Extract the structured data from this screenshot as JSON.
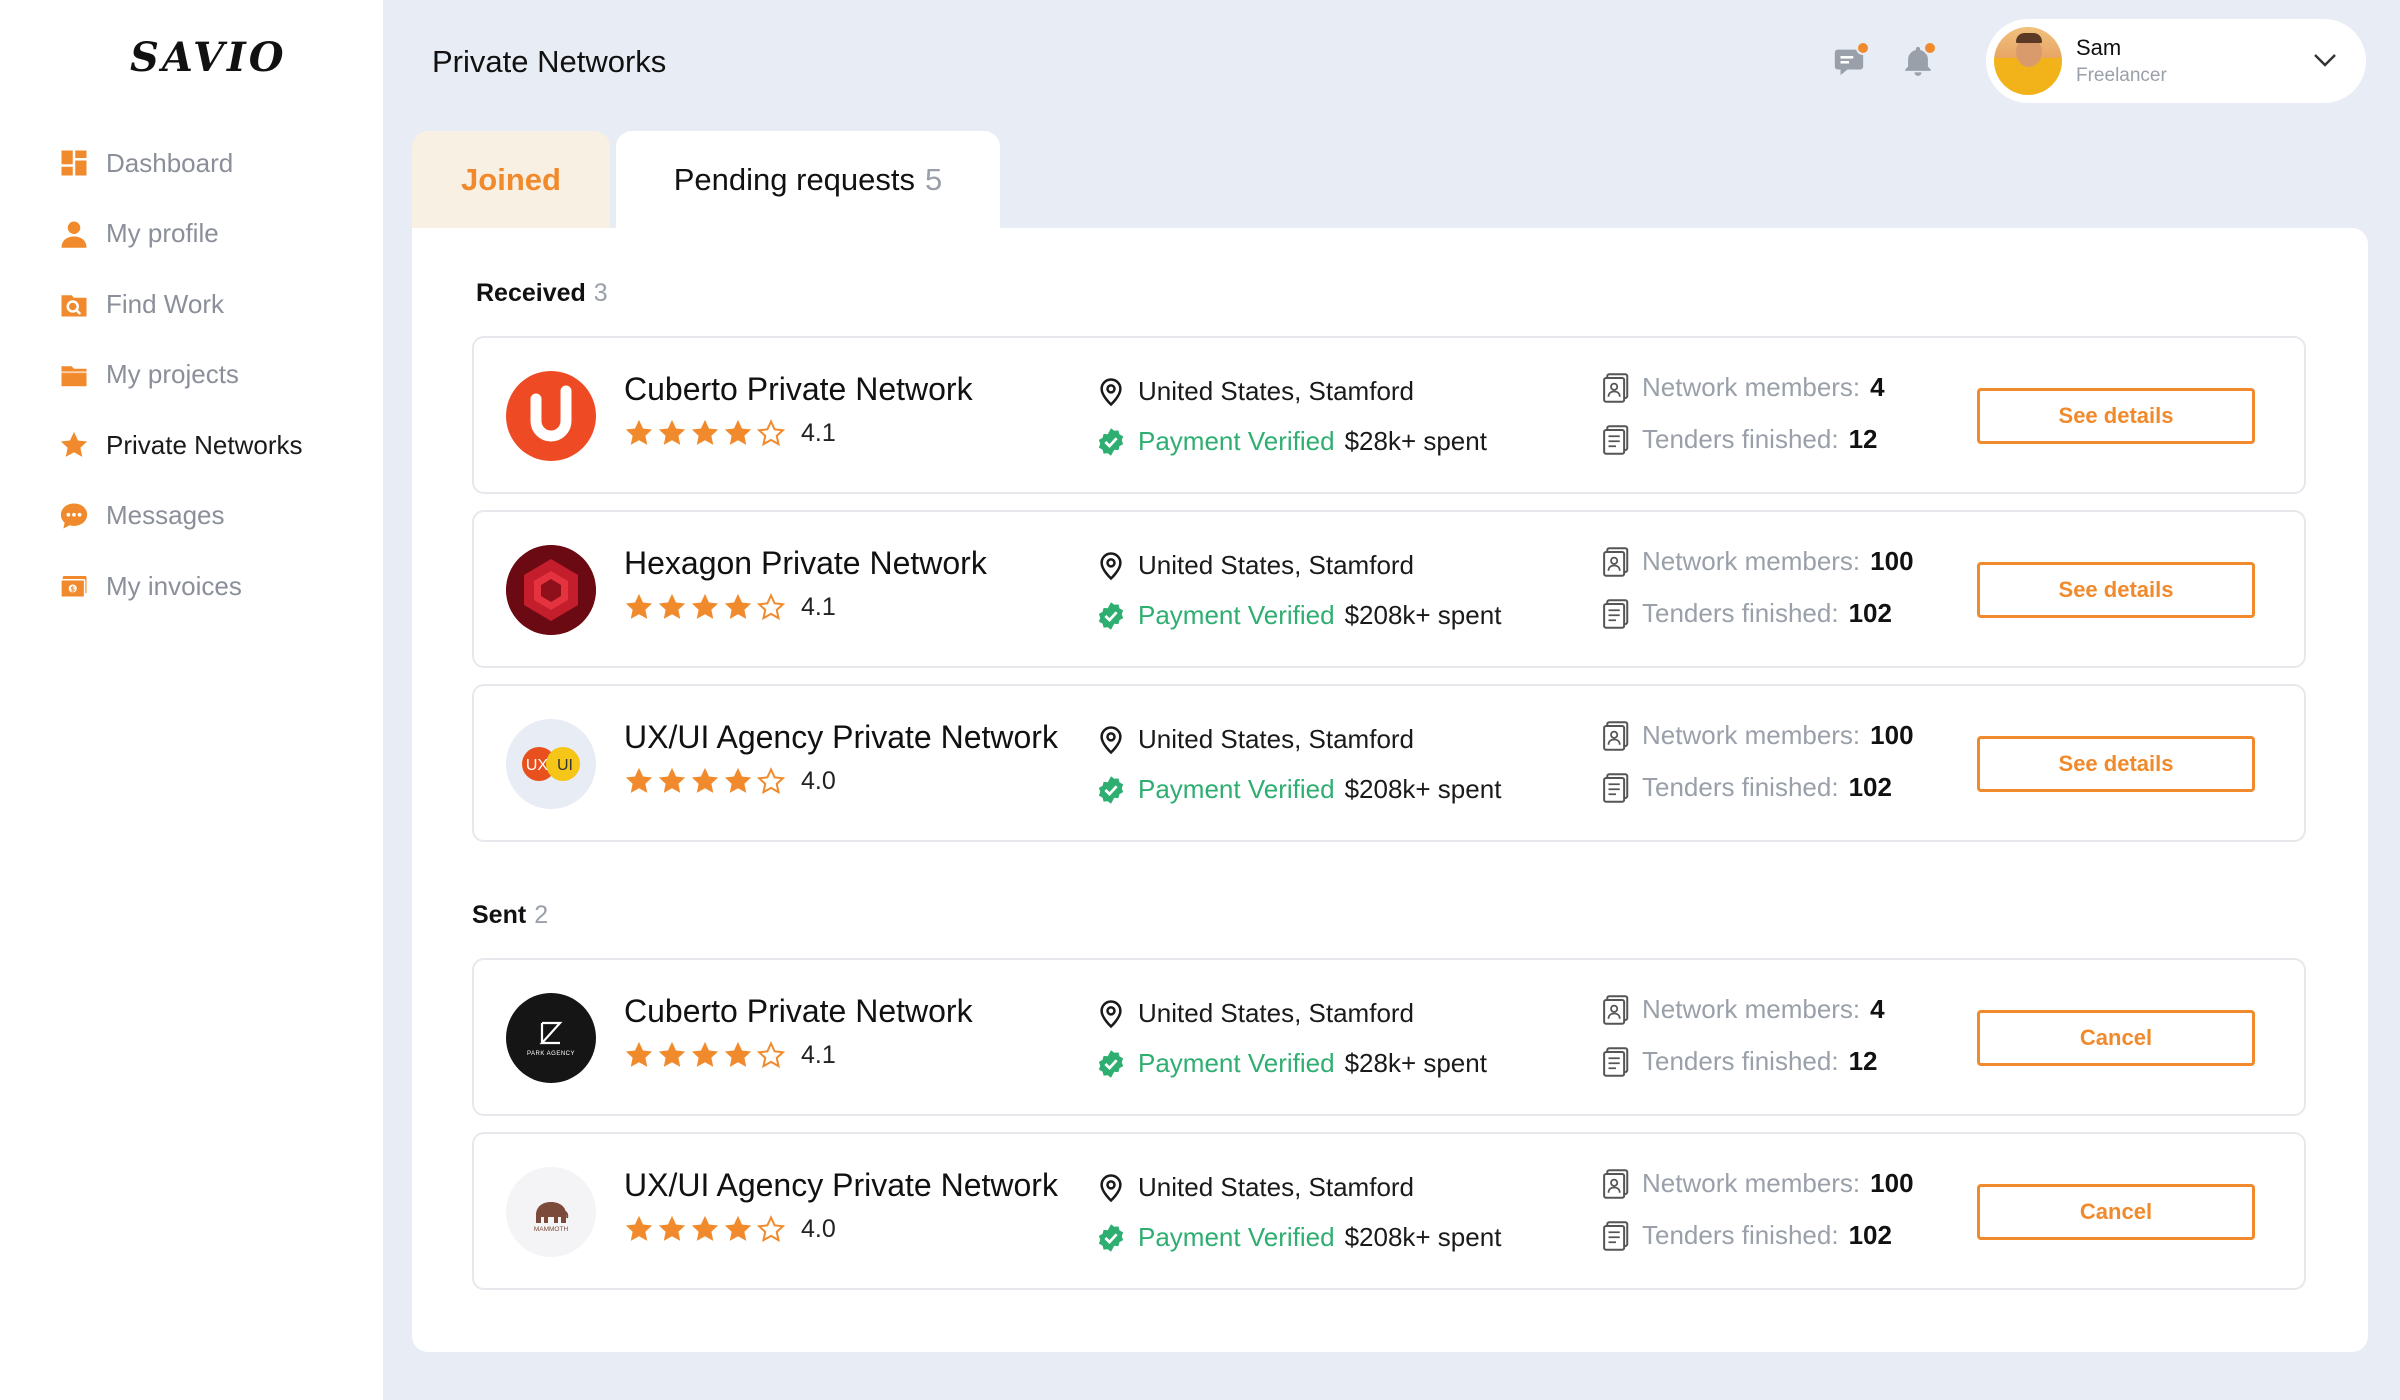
{
  "app": {
    "logo": "SAVIO"
  },
  "sidebar": {
    "items": [
      {
        "label": "Dashboard",
        "icon": "dashboard-icon",
        "active": false
      },
      {
        "label": "My profile",
        "icon": "user-icon",
        "active": false
      },
      {
        "label": "Find Work",
        "icon": "find-work-icon",
        "active": false
      },
      {
        "label": "My projects",
        "icon": "folder-icon",
        "active": false
      },
      {
        "label": "Private Networks",
        "icon": "star-icon",
        "active": true
      },
      {
        "label": "Messages",
        "icon": "chat-icon",
        "active": false
      },
      {
        "label": "My invoices",
        "icon": "invoice-icon",
        "active": false
      }
    ]
  },
  "header": {
    "title": "Private Networks",
    "user": {
      "name": "Sam",
      "role": "Freelancer"
    }
  },
  "tabs": {
    "joined": "Joined",
    "pending": "Pending requests",
    "pending_count": "5"
  },
  "sections": {
    "received": {
      "label": "Received",
      "count": "3"
    },
    "sent": {
      "label": "Sent",
      "count": "2"
    }
  },
  "labels": {
    "payment_verified": "Payment Verified",
    "network_members": "Network members:",
    "tenders_finished": "Tenders finished:"
  },
  "received": [
    {
      "name": "Cuberto Private Network",
      "stars": 4,
      "rating": "4.1",
      "location": "United States, Stamford",
      "spent": "$28k+ spent",
      "members": "4",
      "tenders": "12",
      "button": "See details",
      "logo": "cuberto-logo"
    },
    {
      "name": "Hexagon Private Network",
      "stars": 4,
      "rating": "4.1",
      "location": "United States, Stamford",
      "spent": "$208k+ spent",
      "members": "100",
      "tenders": "102",
      "button": "See details",
      "logo": "hexagon-logo"
    },
    {
      "name": "UX/UI Agency Private Network",
      "stars": 4,
      "rating": "4.0",
      "location": "United States, Stamford",
      "spent": "$208k+ spent",
      "members": "100",
      "tenders": "102",
      "button": "See details",
      "logo": "uxui-logo",
      "logo_text": [
        "UX",
        "UI"
      ]
    }
  ],
  "sent": [
    {
      "name": "Cuberto Private Network",
      "stars": 4,
      "rating": "4.1",
      "location": "United States, Stamford",
      "spent": "$28k+ spent",
      "members": "4",
      "tenders": "12",
      "button": "Cancel",
      "logo": "park-agency-logo",
      "logo_text": "PARK AGENCY"
    },
    {
      "name": "UX/UI Agency Private Network",
      "stars": 4,
      "rating": "4.0",
      "location": "United States, Stamford",
      "spent": "$208k+ spent",
      "members": "100",
      "tenders": "102",
      "button": "Cancel",
      "logo": "mammoth-logo",
      "logo_text": "MAMMOTH"
    }
  ],
  "colors": {
    "accent": "#f08a2c",
    "verified": "#2fae72",
    "muted": "#9aa0aa",
    "background": "#e8ecf4"
  }
}
